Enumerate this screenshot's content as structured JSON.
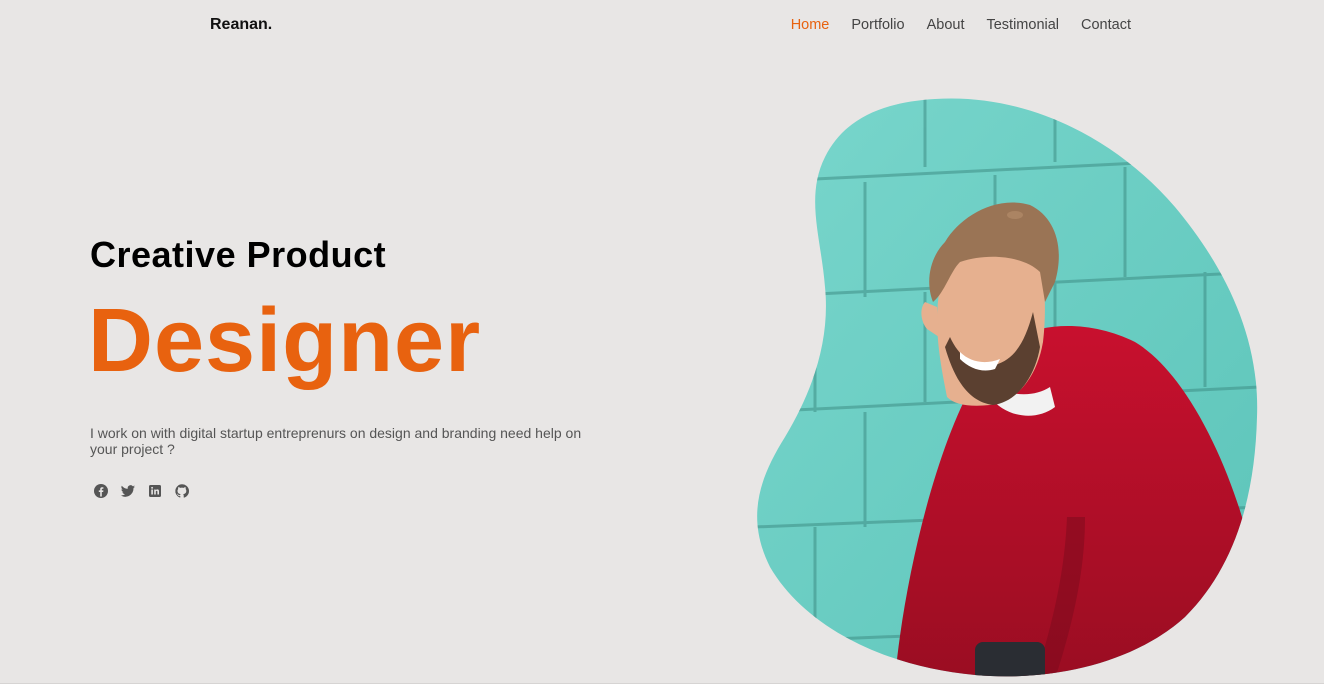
{
  "brand": {
    "logo": "Reanan."
  },
  "nav": {
    "items": [
      {
        "label": "Home",
        "active": true
      },
      {
        "label": "Portfolio",
        "active": false
      },
      {
        "label": "About",
        "active": false
      },
      {
        "label": "Testimonial",
        "active": false
      },
      {
        "label": "Contact",
        "active": false
      }
    ]
  },
  "hero": {
    "headline": "Creative Product",
    "title": "Designer",
    "blurb": "I work on with digital startup entreprenurs on design and branding need help on your project ?"
  },
  "socials": [
    {
      "icon": "facebook-icon"
    },
    {
      "icon": "twitter-icon"
    },
    {
      "icon": "linkedin-icon"
    },
    {
      "icon": "github-icon"
    }
  ],
  "colors": {
    "accent": "#e8620f",
    "background": "#e8e6e5",
    "text": "#111111",
    "muted": "#555555",
    "wall": "#6fd0c6",
    "sweater": "#b0102a"
  }
}
